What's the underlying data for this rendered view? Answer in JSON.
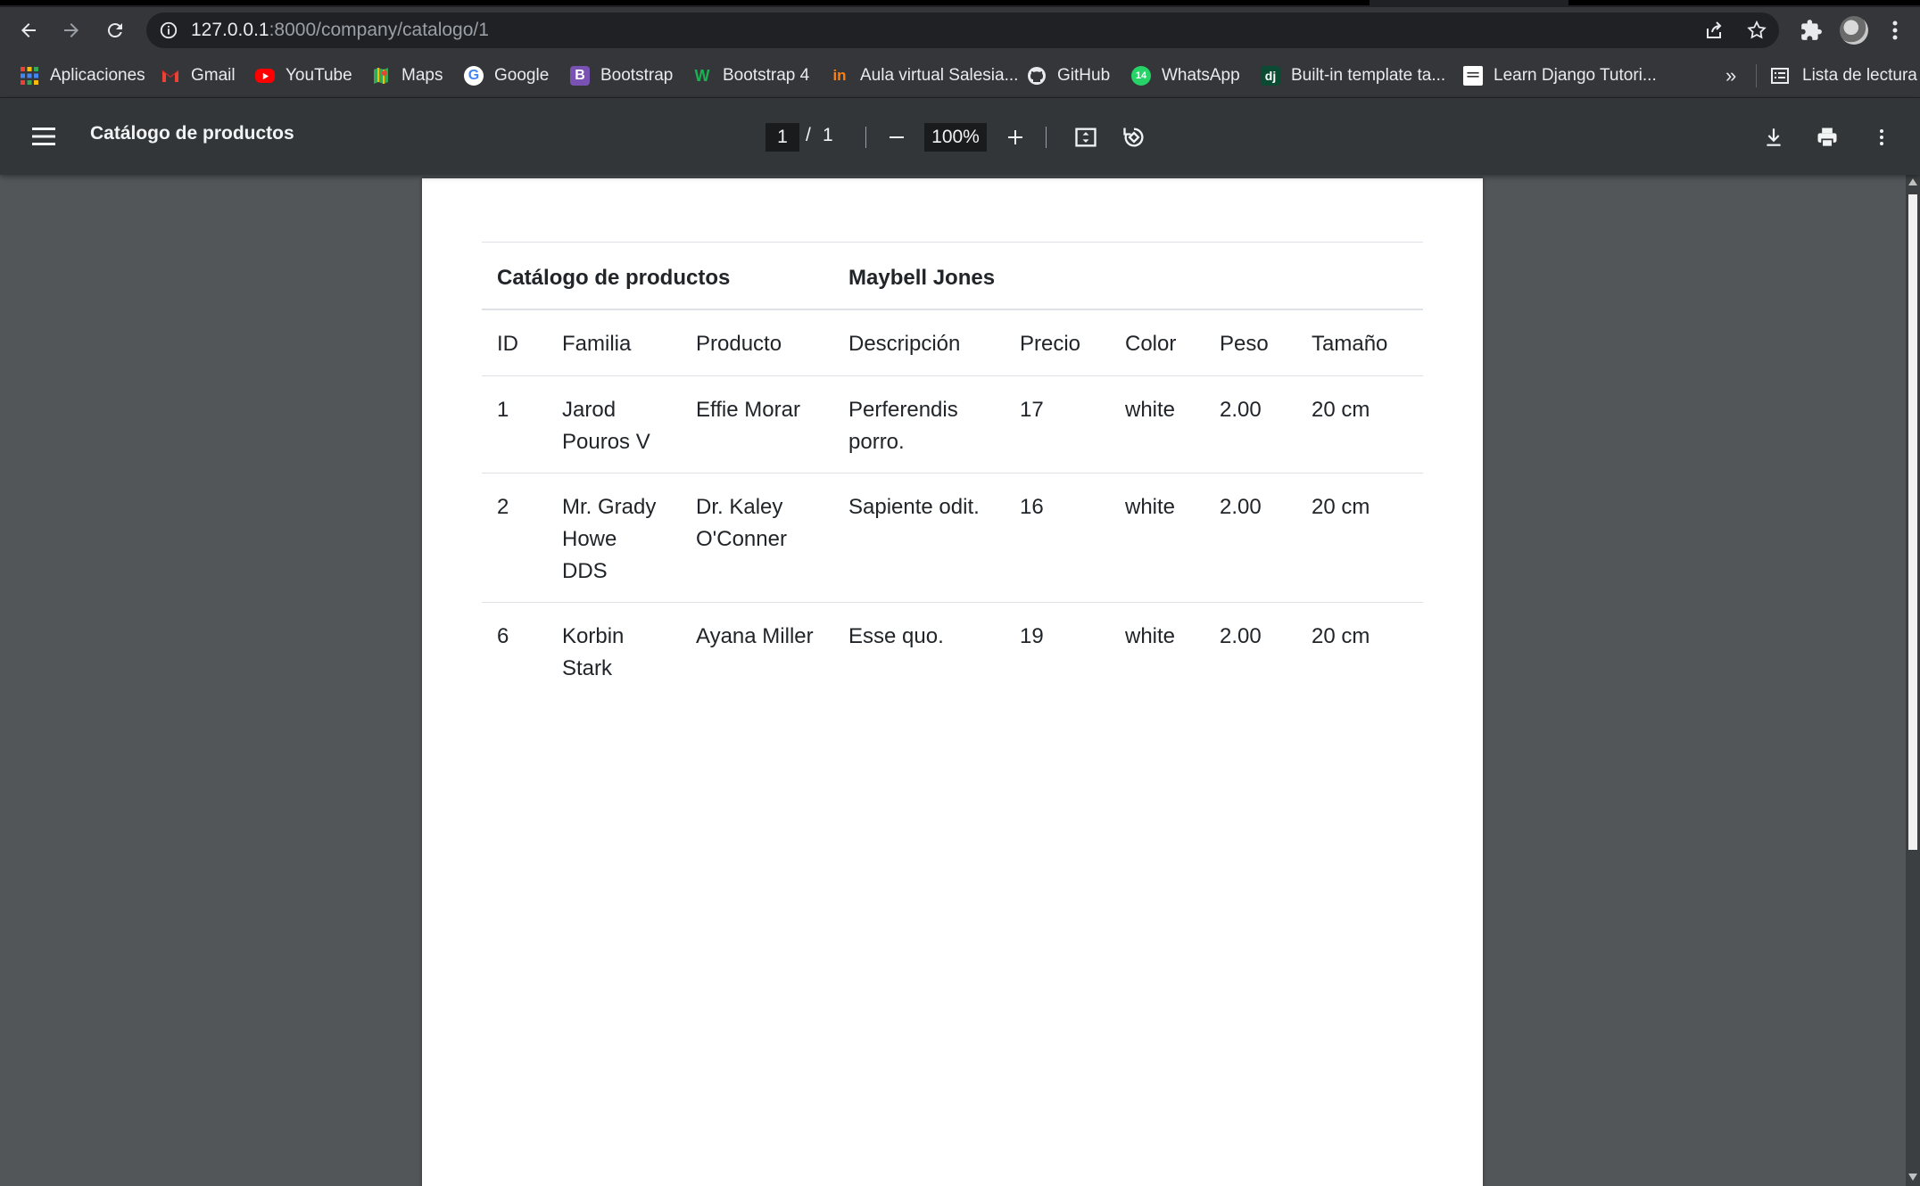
{
  "browser": {
    "url_host": "127.0.0.1",
    "url_path": ":8000/company/catalogo/1"
  },
  "bookmarks": {
    "items": [
      {
        "label": "Aplicaciones",
        "icon": "apps-grid-icon"
      },
      {
        "label": "Gmail",
        "icon": "gmail-icon"
      },
      {
        "label": "YouTube",
        "icon": "youtube-icon"
      },
      {
        "label": "Maps",
        "icon": "maps-icon"
      },
      {
        "label": "Google",
        "icon": "google-icon"
      },
      {
        "label": "Bootstrap",
        "icon": "bootstrap-icon"
      },
      {
        "label": "Bootstrap 4",
        "icon": "w-icon"
      },
      {
        "label": "Aula virtual Salesia...",
        "icon": "in-icon"
      },
      {
        "label": "GitHub",
        "icon": "github-icon"
      },
      {
        "label": "WhatsApp",
        "icon": "whatsapp-icon"
      },
      {
        "label": "Built-in template ta...",
        "icon": "dj-icon"
      },
      {
        "label": "Learn Django Tutori...",
        "icon": "page-icon"
      }
    ],
    "more": "»",
    "reading_list": "Lista de lectura"
  },
  "pdf": {
    "title": "Catálogo de productos",
    "page_current": "1",
    "page_sep": "/",
    "page_total": "1",
    "zoom": "100%"
  },
  "document": {
    "title": "Catálogo de productos",
    "company": "Maybell Jones",
    "columns": [
      "ID",
      "Familia",
      "Producto",
      "Descripción",
      "Precio",
      "Color",
      "Peso",
      "Tamaño"
    ],
    "rows": [
      [
        "1",
        "Jarod Pouros V",
        "Effie Morar",
        "Perferendis porro.",
        "17",
        "white",
        "2.00",
        "20 cm"
      ],
      [
        "2",
        "Mr. Grady Howe DDS",
        "Dr. Kaley O'Conner",
        "Sapiente odit.",
        "16",
        "white",
        "2.00",
        "20 cm"
      ],
      [
        "6",
        "Korbin Stark",
        "Ayana Miller",
        "Esse quo.",
        "19",
        "white",
        "2.00",
        "20 cm"
      ]
    ]
  },
  "colors": {
    "chrome_bg": "#35363a",
    "pdf_toolbar": "#323639",
    "viewer_bg": "#525659",
    "page_bg": "#ffffff"
  }
}
